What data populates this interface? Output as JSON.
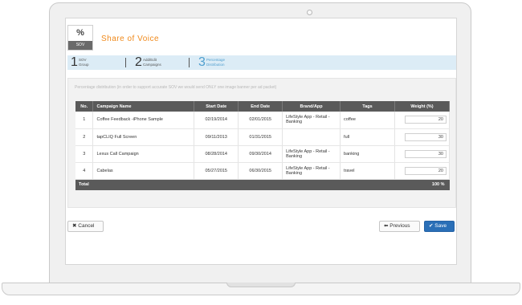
{
  "header": {
    "icon_glyph": "%",
    "icon_label": "SOV",
    "title": "Share of Voice"
  },
  "steps": [
    {
      "num": "1",
      "label_line1": "SOV",
      "label_line2": "Group",
      "active": false
    },
    {
      "num": "2",
      "label_line1": "Add/Edit",
      "label_line2": "Campaigns",
      "active": false
    },
    {
      "num": "3",
      "label_line1": "Percentage",
      "label_line2": "Distribution",
      "active": true
    }
  ],
  "note": "Percentage distribution (in order to support accurate SOV we would send ONLY one image banner per ad packet)",
  "table": {
    "headers": [
      "No.",
      "Campaign Name",
      "Start Date",
      "End Date",
      "Brand/App",
      "Tags",
      "Weight (%)"
    ],
    "rows": [
      {
        "no": "1",
        "campaign": "Coffee Feedback -iPhone Sample",
        "start": "02/19/2014",
        "end": "02/01/2015",
        "brand": "LifeStyle App - Retail - Banking",
        "tags": "coffee",
        "weight": "20"
      },
      {
        "no": "2",
        "campaign": "tapCLIQ Full Screen",
        "start": "09/11/2013",
        "end": "01/31/2015",
        "brand": "",
        "tags": "full",
        "weight": "30"
      },
      {
        "no": "3",
        "campaign": "Lexus Call Campaign",
        "start": "08/28/2014",
        "end": "09/30/2014",
        "brand": "LifeStyle App - Retail - Banking",
        "tags": "banking",
        "weight": "30"
      },
      {
        "no": "4",
        "campaign": "Cabelas",
        "start": "05/27/2015",
        "end": "06/30/2015",
        "brand": "LifeStyle App - Retail - Banking",
        "tags": "travel",
        "weight": "20"
      }
    ],
    "total_label": "Total",
    "total_value": "100 %"
  },
  "buttons": {
    "cancel_icon": "✖",
    "cancel_label": "Cancel",
    "previous_icon": "⬅",
    "previous_label": "Previous",
    "save_icon": "✔",
    "save_label": "Save"
  },
  "colors": {
    "title": "#f08a1c",
    "steps_bg": "#dcecf6",
    "active_step": "#4f9fcf",
    "table_header": "#5a5a5a",
    "save_button": "#2a6fb7"
  }
}
